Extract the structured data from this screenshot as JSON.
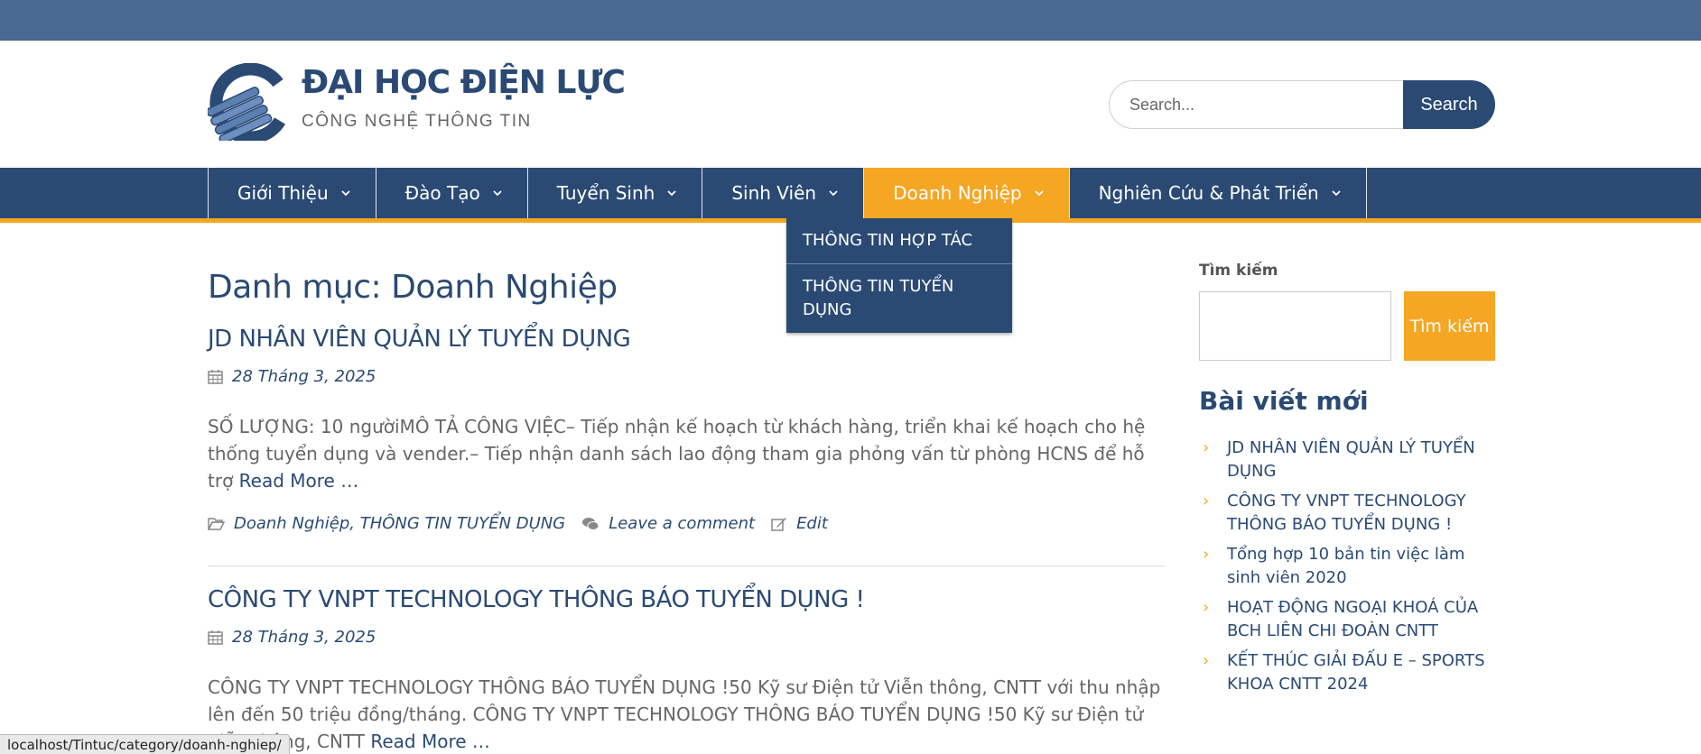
{
  "brand": {
    "title": "ĐẠI HỌC ĐIỆN LỰC",
    "subtitle": "CÔNG NGHỆ THÔNG TIN"
  },
  "header_search": {
    "placeholder": "Search...",
    "button_label": "Search"
  },
  "nav": {
    "items": [
      {
        "label": "Giới Thiệu"
      },
      {
        "label": "Đào Tạo"
      },
      {
        "label": "Tuyển Sinh"
      },
      {
        "label": "Sinh Viên"
      },
      {
        "label": "Doanh Nghiệp"
      },
      {
        "label": "Nghiên Cứu & Phát Triển"
      }
    ],
    "active_index": 4,
    "dropdown": [
      {
        "label": "THÔNG TIN HỢP TÁC"
      },
      {
        "label": "THÔNG TIN TUYỂN DỤNG"
      }
    ]
  },
  "main": {
    "category_title": "Danh mục: Doanh Nghiệp",
    "posts": [
      {
        "title": "JD NHÂN VIÊN QUẢN LÝ TUYỂN DỤNG",
        "date": "28 Tháng 3, 2025",
        "excerpt": "SỐ LƯỢNG: 10 ngườiMÔ TẢ CÔNG VIỆC– Tiếp nhận kế hoạch từ khách hàng, triển khai kế hoạch cho hệ thống tuyển dụng và vender.– Tiếp nhận danh sách lao động tham gia phỏng vấn từ phòng HCNS để hỗ trợ",
        "read_more": "Read More …",
        "categories": [
          "Doanh Nghiệp",
          "THÔNG TIN TUYỂN DỤNG"
        ],
        "comment_label": "Leave a comment",
        "edit_label": "Edit"
      },
      {
        "title": "CÔNG TY VNPT TECHNOLOGY THÔNG BÁO TUYỂN DỤNG !",
        "date": "28 Tháng 3, 2025",
        "excerpt": "CÔNG TY VNPT TECHNOLOGY THÔNG BÁO TUYỂN DỤNG !50 Kỹ sư Điện tử Viễn thông, CNTT với thu nhập lên đến 50 triệu đồng/tháng. CÔNG TY VNPT TECHNOLOGY THÔNG BÁO TUYỂN DỤNG !50 Kỹ sư Điện tử Viễn thông, CNTT",
        "read_more": "Read More …"
      }
    ]
  },
  "sidebar": {
    "search_label": "Tìm kiếm",
    "search_button": "Tìm kiếm",
    "recent_heading": "Bài viết mới",
    "recent": [
      "JD NHÂN VIÊN QUẢN LÝ TUYỂN DỤNG",
      "CÔNG TY VNPT TECHNOLOGY THÔNG BÁO TUYỂN DỤNG !",
      "Tổng hợp 10 bản tin việc làm sinh viên 2020",
      "HOẠT ĐỘNG NGOẠI KHOÁ CỦA BCH LIÊN CHI ĐOÀN CNTT",
      "KẾT THÚC GIẢI ĐẤU E – SPORTS KHOA CNTT 2024"
    ]
  },
  "status_url": "localhost/Tintuc/category/doanh-nghiep/",
  "colors": {
    "primary": "#2a4a74",
    "accent": "#f5a623",
    "topbar": "#4a6a92"
  },
  "icons": [
    "logo-icon",
    "chevron-down-icon",
    "calendar-icon",
    "folder-icon",
    "comments-icon",
    "edit-icon",
    "arrow-right-icon"
  ]
}
